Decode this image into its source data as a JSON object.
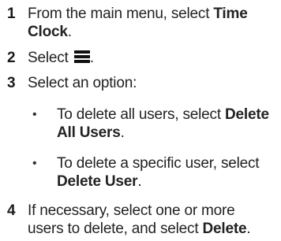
{
  "steps": [
    {
      "number": "1",
      "text_prefix": "From the main menu, select ",
      "text_bold": "Time Clock",
      "line1_plain": "From the main menu, select ",
      "line1_bold": "Time",
      "line2_bold": "Clock",
      "line2_plain": "."
    },
    {
      "number": "2",
      "text": "Select ",
      "icon": "menu-icon",
      "suffix": "."
    },
    {
      "number": "3",
      "text": "Select an option:",
      "bullets": [
        {
          "line1_plain": "To delete all users, select ",
          "line1_bold": "Delete",
          "line2_bold": "All Users",
          "line2_plain": "."
        },
        {
          "line1_plain": "To delete a specific user, select",
          "line2_bold": "Delete User",
          "line2_plain": "."
        }
      ]
    },
    {
      "number": "4",
      "line1_plain": "If necessary, select one or more",
      "line2_plain": "users to delete, and select ",
      "line2_bold": "Delete",
      "line2_end": "."
    }
  ],
  "bullet_char": "•"
}
